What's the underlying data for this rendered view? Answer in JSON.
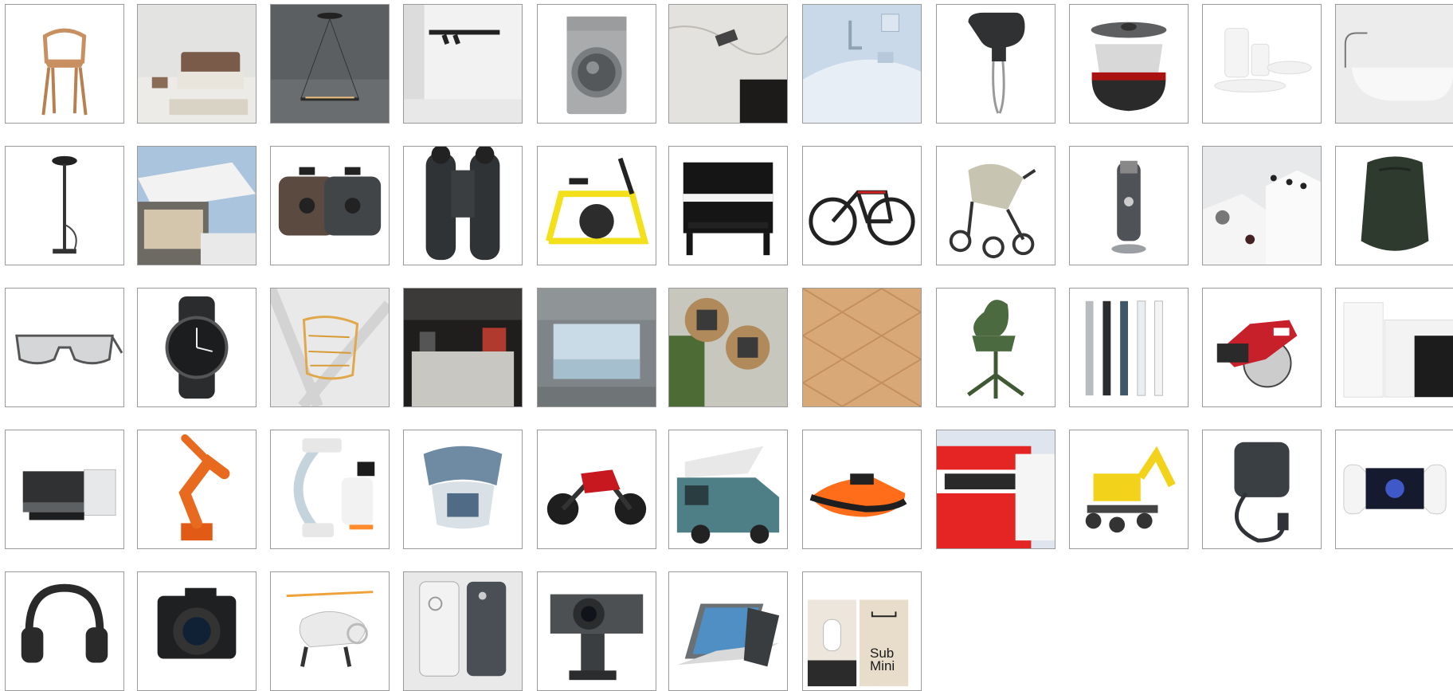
{
  "grid": {
    "background": "#ffffff",
    "tile_border": "#9a9a9a",
    "tiles": [
      {
        "name": "chair-tile",
        "icon": "wooden-chair-icon"
      },
      {
        "name": "bed-tile",
        "icon": "bed-icon"
      },
      {
        "name": "pendant-lamp-tile",
        "icon": "pendant-lamp-icon"
      },
      {
        "name": "spotlight-track-tile",
        "icon": "track-spotlight-icon"
      },
      {
        "name": "washing-machine-tile",
        "icon": "washing-machine-icon"
      },
      {
        "name": "marble-kitchen-tile",
        "icon": "marble-countertop-icon"
      },
      {
        "name": "washbasin-faucet-tile",
        "icon": "faucet-basin-icon"
      },
      {
        "name": "hand-mixer-tile",
        "icon": "hand-mixer-icon"
      },
      {
        "name": "cookware-pot-tile",
        "icon": "cooking-pot-icon"
      },
      {
        "name": "tableware-set-tile",
        "icon": "tableware-icon"
      },
      {
        "name": "bathtub-tile",
        "icon": "bathtub-icon"
      },
      {
        "name": "shower-system-tile",
        "icon": "shower-icon"
      },
      {
        "name": "awning-terrace-tile",
        "icon": "awning-house-icon"
      },
      {
        "name": "bag-pair-tile",
        "icon": "bags-icon"
      },
      {
        "name": "binoculars-tile",
        "icon": "binoculars-icon"
      },
      {
        "name": "exercise-bike-tile",
        "icon": "exercise-bike-icon"
      },
      {
        "name": "piano-tile",
        "icon": "upright-piano-icon"
      },
      {
        "name": "road-bike-tile",
        "icon": "bicycle-icon"
      },
      {
        "name": "stroller-tile",
        "icon": "stroller-icon"
      },
      {
        "name": "trimmer-tile",
        "icon": "beard-trimmer-icon"
      },
      {
        "name": "tiles-display-tile",
        "icon": "display-steps-icon"
      },
      {
        "name": "backpack-tile",
        "icon": "backpack-icon"
      },
      {
        "name": "sunglasses-tile",
        "icon": "glasses-icon"
      },
      {
        "name": "wristwatch-tile",
        "icon": "watch-icon"
      },
      {
        "name": "gold-cuff-tile",
        "icon": "cuff-bracelet-icon"
      },
      {
        "name": "store-interior-tile",
        "icon": "store-interior-icon"
      },
      {
        "name": "window-room-tile",
        "icon": "panorama-window-icon"
      },
      {
        "name": "plaza-aerial-tile",
        "icon": "aerial-plaza-icon"
      },
      {
        "name": "wood-pattern-tile",
        "icon": "wood-parquet-icon"
      },
      {
        "name": "green-chair-tile",
        "icon": "office-chair-icon"
      },
      {
        "name": "pens-tile",
        "icon": "pens-icon"
      },
      {
        "name": "circular-saw-tile",
        "icon": "circular-saw-icon"
      },
      {
        "name": "heat-pump-tile",
        "icon": "heat-pump-icon"
      },
      {
        "name": "printer-tile",
        "icon": "printer-icon"
      },
      {
        "name": "robot-arm-tile",
        "icon": "robot-arm-icon"
      },
      {
        "name": "c-arm-xray-tile",
        "icon": "c-arm-icon"
      },
      {
        "name": "neck-brace-tile",
        "icon": "neck-brace-icon"
      },
      {
        "name": "motorcycle-tile",
        "icon": "motorcycle-icon"
      },
      {
        "name": "camper-van-tile",
        "icon": "camper-van-icon"
      },
      {
        "name": "jet-ski-tile",
        "icon": "jet-ski-icon"
      },
      {
        "name": "tram-tile",
        "icon": "tram-icon"
      },
      {
        "name": "excavator-tile",
        "icon": "excavator-icon"
      },
      {
        "name": "ev-charger-tile",
        "icon": "ev-charger-icon"
      },
      {
        "name": "game-handheld-tile",
        "icon": "handheld-console-icon"
      },
      {
        "name": "headphones-tile",
        "icon": "headphones-icon"
      },
      {
        "name": "camera-tile",
        "icon": "camera-icon"
      },
      {
        "name": "drone-tile",
        "icon": "drone-icon"
      },
      {
        "name": "phone-tile",
        "icon": "smartphone-icon"
      },
      {
        "name": "webcam-tile",
        "icon": "webcam-icon"
      },
      {
        "name": "laptop-tile",
        "icon": "laptop-icon"
      },
      {
        "name": "sub-mini-tile",
        "icon": "speaker-box-icon",
        "label": "Sub\nMini"
      }
    ]
  }
}
